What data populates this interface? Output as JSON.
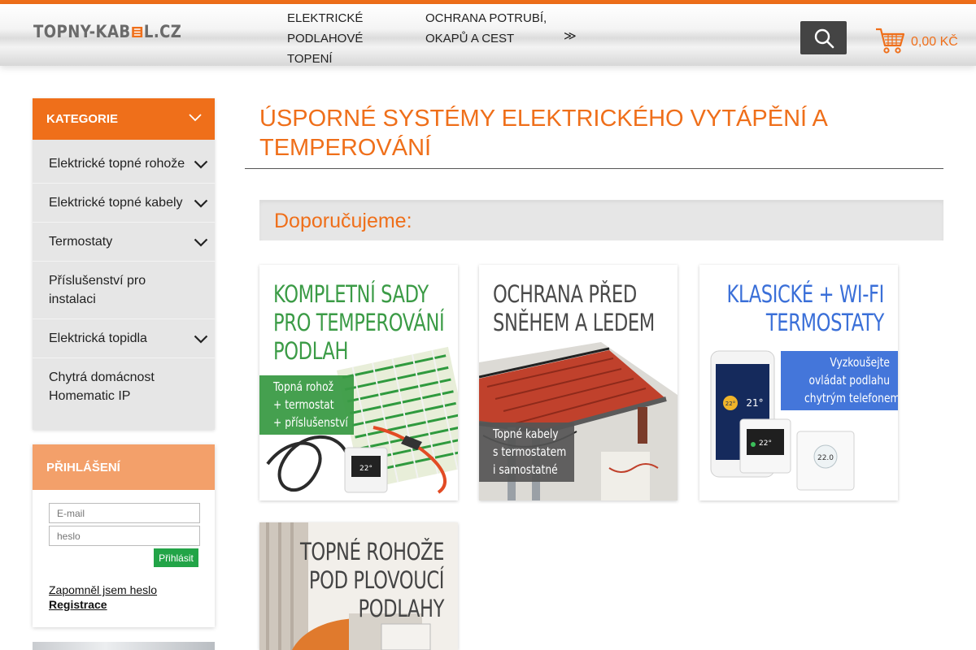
{
  "header": {
    "logo_pre": "TOPNY-KAB",
    "logo_post": "L.CZ",
    "nav": [
      {
        "label": "Elektrické podlahové topení"
      },
      {
        "label": "Ochrana potrubí, okapů a cest"
      }
    ],
    "nav_more": "≫",
    "search_icon": "search-icon",
    "cart_icon": "cart-icon",
    "cart_total": "0,00 Kč",
    "accent": "#ef6f1a"
  },
  "sidebar": {
    "categories_title": "KATEGORIE",
    "categories": [
      {
        "label": "Elektrické topné rohože",
        "has_submenu": true
      },
      {
        "label": "Elektrické topné kabely",
        "has_submenu": true
      },
      {
        "label": "Termostaty",
        "has_submenu": true
      },
      {
        "label": "Příslušenství pro instalaci",
        "has_submenu": false
      },
      {
        "label": "Elektrická topidla",
        "has_submenu": true
      },
      {
        "label": "Chytrá domácnost Homematic IP",
        "has_submenu": false
      }
    ],
    "login": {
      "title": "PŘIHLÁŠENÍ",
      "email_placeholder": "E-mail",
      "password_placeholder": "heslo",
      "submit_label": "Přihlásit",
      "forgot_label": "Zapomněl jsem heslo",
      "register_label": "Registrace"
    }
  },
  "main": {
    "title": "Úsporné systémy elektrického vytápění a temperování",
    "recommend_title": "Doporučujeme:",
    "cards": [
      {
        "title_lines": [
          "Kompletní sady",
          "pro temperování",
          "podlah"
        ],
        "ribbon_lines": [
          "Topná rohož",
          "+ termostat",
          "+ příslušenství"
        ],
        "title_color": "#3b9b46"
      },
      {
        "title_lines": [
          "Ochrana před",
          "sněhem a ledem"
        ],
        "ribbon_lines": [
          "Topné kabely",
          "s termostatem",
          "i samostatné"
        ],
        "title_color": "#4a4a4a"
      },
      {
        "title_lines": [
          "Klasické + Wi-Fi",
          "termostaty"
        ],
        "ribbon_lines": [
          "Vyzkoušejte",
          "ovládat podlahu",
          "chytrým telefonem!"
        ],
        "phone_temp": "22°",
        "phone_temp2": "21°",
        "thermostat_temp": "22°",
        "thermostat2_temp": "22.0",
        "title_color": "#3a6fd8"
      },
      {
        "title_lines": [
          "Topné rohože",
          "pod plovoucí",
          "podlahy"
        ],
        "title_color": "#444444"
      }
    ],
    "login_button_color": "#22a447"
  }
}
